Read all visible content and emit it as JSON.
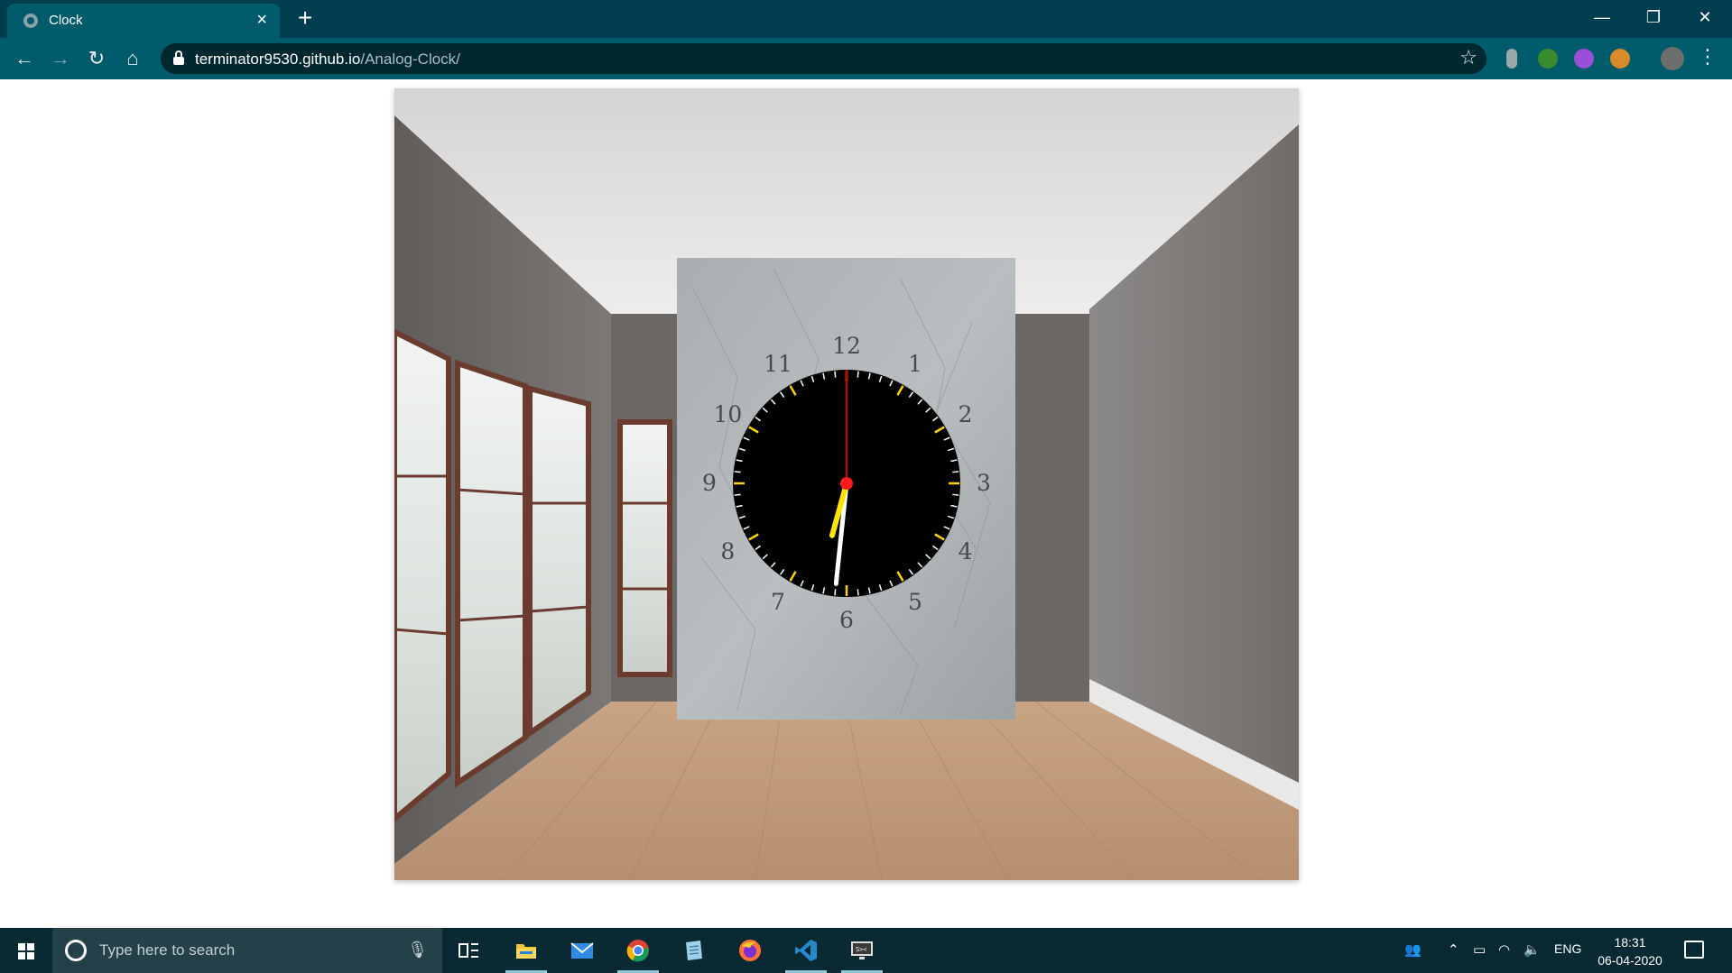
{
  "browser": {
    "tab_title": "Clock",
    "tab_close": "×",
    "new_tab": "+",
    "url_host": "terminator9530.github.io",
    "url_path": "/Analog-Clock/",
    "window_controls": {
      "minimize": "—",
      "restore": "❐",
      "close": "✕"
    },
    "nav": {
      "back": "←",
      "forward": "→",
      "reload": "↻",
      "home": "⌂"
    },
    "bookmark_icon": "☆",
    "menu_icon": "⋮",
    "extensions": [
      {
        "name": "extension-grey-icon",
        "color": "#9aa7ab"
      },
      {
        "name": "extension-tree-icon",
        "color": "#3a8a2e"
      },
      {
        "name": "extension-purple-icon",
        "color": "#9b4fd6"
      },
      {
        "name": "extension-cookie-icon",
        "color": "#d98b2b"
      },
      {
        "name": "profile-avatar-icon",
        "color": "#6d6d6d"
      }
    ],
    "colors": {
      "tabbar": "#003e50",
      "toolbar": "#005b6b",
      "omnibox": "#00292f"
    }
  },
  "clock": {
    "numerals": [
      "12",
      "1",
      "2",
      "3",
      "4",
      "5",
      "6",
      "7",
      "8",
      "9",
      "10",
      "11"
    ],
    "time": {
      "hours": 6,
      "minutes": 31,
      "seconds": 0
    },
    "colors": {
      "face": "#000000",
      "hour_hand": "#ffe600",
      "minute_hand": "#ffffff",
      "second_hand": "#d40000",
      "center": "#ff1a1a",
      "tick_major": "#ffd400",
      "tick_minor": "#ffffff"
    }
  },
  "taskbar": {
    "search_placeholder": "Type here to search",
    "apps": [
      {
        "name": "task-view",
        "active": false
      },
      {
        "name": "file-explorer",
        "active": true
      },
      {
        "name": "mail",
        "active": false
      },
      {
        "name": "chrome",
        "active": true
      },
      {
        "name": "notepad",
        "active": false
      },
      {
        "name": "firefox",
        "active": false
      },
      {
        "name": "vscode",
        "active": true
      },
      {
        "name": "terminal",
        "active": true
      }
    ],
    "language": "ENG",
    "time": "18:31",
    "date": "06-04-2020"
  }
}
